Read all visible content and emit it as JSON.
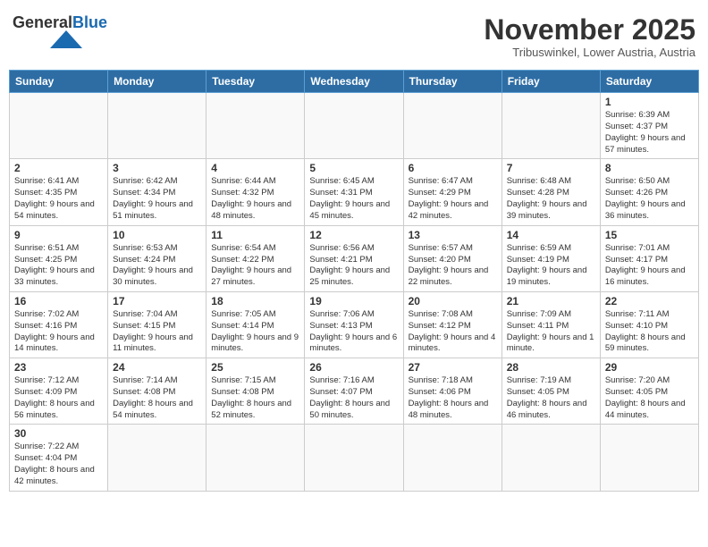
{
  "header": {
    "logo_general": "General",
    "logo_blue": "Blue",
    "month_title": "November 2025",
    "subtitle": "Tribuswinkel, Lower Austria, Austria"
  },
  "weekdays": [
    "Sunday",
    "Monday",
    "Tuesday",
    "Wednesday",
    "Thursday",
    "Friday",
    "Saturday"
  ],
  "weeks": [
    [
      {
        "day": "",
        "info": ""
      },
      {
        "day": "",
        "info": ""
      },
      {
        "day": "",
        "info": ""
      },
      {
        "day": "",
        "info": ""
      },
      {
        "day": "",
        "info": ""
      },
      {
        "day": "",
        "info": ""
      },
      {
        "day": "1",
        "info": "Sunrise: 6:39 AM\nSunset: 4:37 PM\nDaylight: 9 hours\nand 57 minutes."
      }
    ],
    [
      {
        "day": "2",
        "info": "Sunrise: 6:41 AM\nSunset: 4:35 PM\nDaylight: 9 hours\nand 54 minutes."
      },
      {
        "day": "3",
        "info": "Sunrise: 6:42 AM\nSunset: 4:34 PM\nDaylight: 9 hours\nand 51 minutes."
      },
      {
        "day": "4",
        "info": "Sunrise: 6:44 AM\nSunset: 4:32 PM\nDaylight: 9 hours\nand 48 minutes."
      },
      {
        "day": "5",
        "info": "Sunrise: 6:45 AM\nSunset: 4:31 PM\nDaylight: 9 hours\nand 45 minutes."
      },
      {
        "day": "6",
        "info": "Sunrise: 6:47 AM\nSunset: 4:29 PM\nDaylight: 9 hours\nand 42 minutes."
      },
      {
        "day": "7",
        "info": "Sunrise: 6:48 AM\nSunset: 4:28 PM\nDaylight: 9 hours\nand 39 minutes."
      },
      {
        "day": "8",
        "info": "Sunrise: 6:50 AM\nSunset: 4:26 PM\nDaylight: 9 hours\nand 36 minutes."
      }
    ],
    [
      {
        "day": "9",
        "info": "Sunrise: 6:51 AM\nSunset: 4:25 PM\nDaylight: 9 hours\nand 33 minutes."
      },
      {
        "day": "10",
        "info": "Sunrise: 6:53 AM\nSunset: 4:24 PM\nDaylight: 9 hours\nand 30 minutes."
      },
      {
        "day": "11",
        "info": "Sunrise: 6:54 AM\nSunset: 4:22 PM\nDaylight: 9 hours\nand 27 minutes."
      },
      {
        "day": "12",
        "info": "Sunrise: 6:56 AM\nSunset: 4:21 PM\nDaylight: 9 hours\nand 25 minutes."
      },
      {
        "day": "13",
        "info": "Sunrise: 6:57 AM\nSunset: 4:20 PM\nDaylight: 9 hours\nand 22 minutes."
      },
      {
        "day": "14",
        "info": "Sunrise: 6:59 AM\nSunset: 4:19 PM\nDaylight: 9 hours\nand 19 minutes."
      },
      {
        "day": "15",
        "info": "Sunrise: 7:01 AM\nSunset: 4:17 PM\nDaylight: 9 hours\nand 16 minutes."
      }
    ],
    [
      {
        "day": "16",
        "info": "Sunrise: 7:02 AM\nSunset: 4:16 PM\nDaylight: 9 hours\nand 14 minutes."
      },
      {
        "day": "17",
        "info": "Sunrise: 7:04 AM\nSunset: 4:15 PM\nDaylight: 9 hours\nand 11 minutes."
      },
      {
        "day": "18",
        "info": "Sunrise: 7:05 AM\nSunset: 4:14 PM\nDaylight: 9 hours\nand 9 minutes."
      },
      {
        "day": "19",
        "info": "Sunrise: 7:06 AM\nSunset: 4:13 PM\nDaylight: 9 hours\nand 6 minutes."
      },
      {
        "day": "20",
        "info": "Sunrise: 7:08 AM\nSunset: 4:12 PM\nDaylight: 9 hours\nand 4 minutes."
      },
      {
        "day": "21",
        "info": "Sunrise: 7:09 AM\nSunset: 4:11 PM\nDaylight: 9 hours\nand 1 minute."
      },
      {
        "day": "22",
        "info": "Sunrise: 7:11 AM\nSunset: 4:10 PM\nDaylight: 8 hours\nand 59 minutes."
      }
    ],
    [
      {
        "day": "23",
        "info": "Sunrise: 7:12 AM\nSunset: 4:09 PM\nDaylight: 8 hours\nand 56 minutes."
      },
      {
        "day": "24",
        "info": "Sunrise: 7:14 AM\nSunset: 4:08 PM\nDaylight: 8 hours\nand 54 minutes."
      },
      {
        "day": "25",
        "info": "Sunrise: 7:15 AM\nSunset: 4:08 PM\nDaylight: 8 hours\nand 52 minutes."
      },
      {
        "day": "26",
        "info": "Sunrise: 7:16 AM\nSunset: 4:07 PM\nDaylight: 8 hours\nand 50 minutes."
      },
      {
        "day": "27",
        "info": "Sunrise: 7:18 AM\nSunset: 4:06 PM\nDaylight: 8 hours\nand 48 minutes."
      },
      {
        "day": "28",
        "info": "Sunrise: 7:19 AM\nSunset: 4:05 PM\nDaylight: 8 hours\nand 46 minutes."
      },
      {
        "day": "29",
        "info": "Sunrise: 7:20 AM\nSunset: 4:05 PM\nDaylight: 8 hours\nand 44 minutes."
      }
    ],
    [
      {
        "day": "30",
        "info": "Sunrise: 7:22 AM\nSunset: 4:04 PM\nDaylight: 8 hours\nand 42 minutes."
      },
      {
        "day": "",
        "info": ""
      },
      {
        "day": "",
        "info": ""
      },
      {
        "day": "",
        "info": ""
      },
      {
        "day": "",
        "info": ""
      },
      {
        "day": "",
        "info": ""
      },
      {
        "day": "",
        "info": ""
      }
    ]
  ]
}
